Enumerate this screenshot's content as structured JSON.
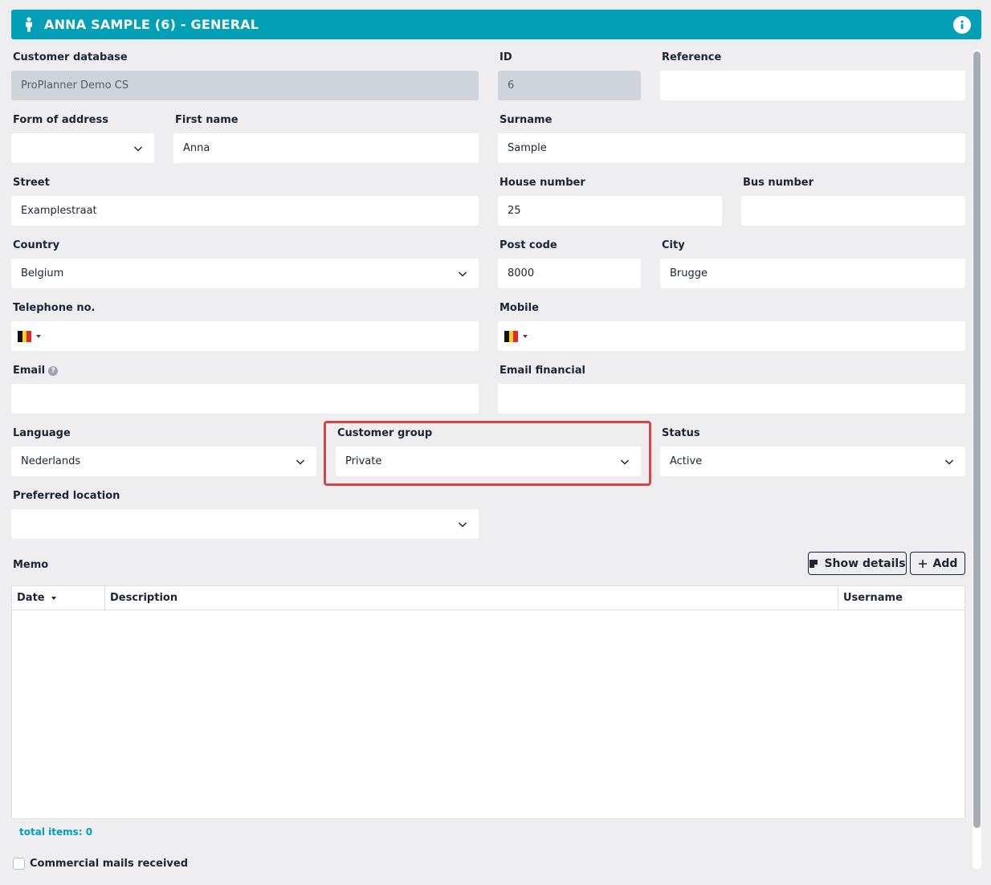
{
  "header": {
    "title": "ANNA SAMPLE (6) - GENERAL",
    "bg": "#039fb6"
  },
  "fields": {
    "customer_database": {
      "label": "Customer database",
      "value": "ProPlanner Demo CS"
    },
    "id": {
      "label": "ID",
      "value": "6"
    },
    "reference": {
      "label": "Reference",
      "value": ""
    },
    "form_of_address": {
      "label": "Form of address",
      "value": ""
    },
    "first_name": {
      "label": "First name",
      "value": "Anna"
    },
    "surname": {
      "label": "Surname",
      "value": "Sample"
    },
    "street": {
      "label": "Street",
      "value": "Examplestraat"
    },
    "house_number": {
      "label": "House number",
      "value": "25"
    },
    "bus_number": {
      "label": "Bus number",
      "value": ""
    },
    "country": {
      "label": "Country",
      "value": "Belgium"
    },
    "post_code": {
      "label": "Post code",
      "value": "8000"
    },
    "city": {
      "label": "City",
      "value": "Brugge"
    },
    "telephone": {
      "label": "Telephone no.",
      "value": ""
    },
    "mobile": {
      "label": "Mobile",
      "value": ""
    },
    "email": {
      "label": "Email",
      "value": ""
    },
    "email_financial": {
      "label": "Email financial",
      "value": ""
    },
    "language": {
      "label": "Language",
      "value": "Nederlands"
    },
    "customer_group": {
      "label": "Customer group",
      "value": "Private"
    },
    "status": {
      "label": "Status",
      "value": "Active"
    },
    "preferred_location": {
      "label": "Preferred location",
      "value": ""
    }
  },
  "memo": {
    "label": "Memo",
    "show_details_label": "Show details",
    "add_label": "Add",
    "columns": [
      "Date",
      "Description",
      "Username"
    ],
    "rows": [],
    "total_text": "total items: 0"
  },
  "commercial_mails": {
    "label": "Commercial mails received",
    "checked": false
  },
  "colors": {
    "accent": "#039fb6",
    "highlight": "#d64545",
    "readonly_bg": "#cfd4da"
  }
}
